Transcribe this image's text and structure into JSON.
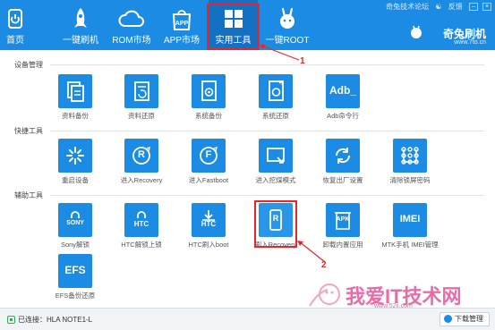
{
  "header": {
    "nav": [
      {
        "label": "首页",
        "icon": "home-icon"
      },
      {
        "label": "一键刷机",
        "icon": "rocket-icon"
      },
      {
        "label": "ROM市场",
        "icon": "cloud-icon"
      },
      {
        "label": "APP市场",
        "icon": "app-bag-icon"
      },
      {
        "label": "实用工具",
        "icon": "grid-icon",
        "active": true
      },
      {
        "label": "一键ROOT",
        "icon": "rabbit-icon"
      }
    ],
    "forum_link": "奇兔技术论坛",
    "feedback": "反馈",
    "brand_name": "奇兔刷机",
    "brand_url": "www.7to.cn"
  },
  "sections": [
    {
      "title": "设备管理",
      "tools": [
        {
          "label": "资料备份",
          "icon": "doc-backup-icon"
        },
        {
          "label": "资料还原",
          "icon": "doc-restore-icon"
        },
        {
          "label": "系统备份",
          "icon": "system-backup-icon"
        },
        {
          "label": "系统还原",
          "icon": "system-restore-icon"
        },
        {
          "label": "Adb命令行",
          "icon": "adb-icon",
          "tile_text": "Adb_"
        }
      ]
    },
    {
      "title": "快捷工具",
      "tools": [
        {
          "label": "重启设备",
          "icon": "restart-icon"
        },
        {
          "label": "进入Recovery",
          "icon": "recovery-r-icon",
          "tile_text": "R"
        },
        {
          "label": "进入Fastboot",
          "icon": "fastboot-f-icon",
          "tile_text": "F"
        },
        {
          "label": "进入挖煤模式",
          "icon": "screen-mode-icon"
        },
        {
          "label": "恢复出厂设置",
          "icon": "factory-reset-icon"
        },
        {
          "label": "清除锁屏密码",
          "icon": "pattern-lock-icon"
        }
      ]
    },
    {
      "title": "辅助工具",
      "tools": [
        {
          "label": "Sony解锁",
          "icon": "sony-icon",
          "tile_text": "SONY"
        },
        {
          "label": "HTC解锁上锁",
          "icon": "htc-lock-icon",
          "tile_text": "HTC"
        },
        {
          "label": "HTC刷入boot",
          "icon": "htc-boot-icon",
          "tile_text": "HTC"
        },
        {
          "label": "刷入Recovery",
          "icon": "flash-recovery-icon",
          "tile_text": "R"
        },
        {
          "label": "卸载内置应用",
          "icon": "apk-icon",
          "tile_text": "APK"
        },
        {
          "label": "MTK手机 IMEI管理",
          "icon": "imei-icon",
          "tile_text": "IMEI"
        },
        {
          "label": "EFS备份还原",
          "icon": "efs-icon",
          "tile_text": "EFS"
        }
      ]
    }
  ],
  "annotations": {
    "marker1": "1",
    "marker2": "2"
  },
  "footer": {
    "status": "已连接：HLA NOTE1-L",
    "download": "下载管理"
  },
  "watermark": {
    "text": "我爱IT技术网",
    "url": "www.52ij.com"
  },
  "colors": {
    "header": "#1b8be3",
    "tile": "#1b8be3",
    "highlight": "#e8262a"
  }
}
